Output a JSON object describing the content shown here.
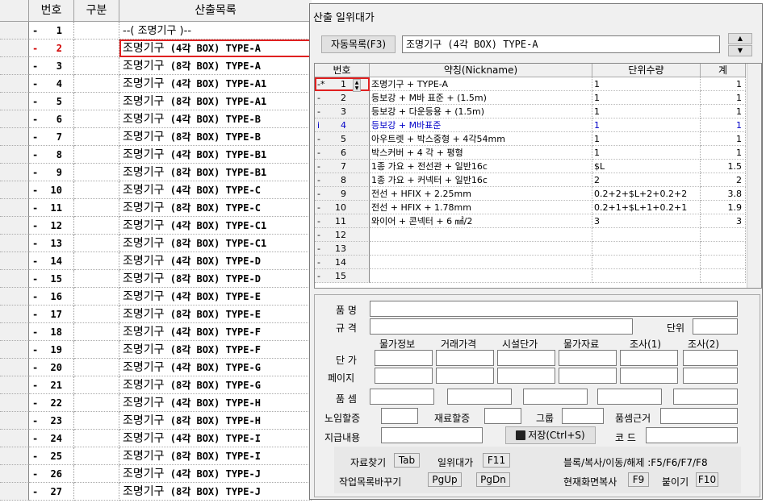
{
  "left_grid": {
    "headers": [
      "번호",
      "구분",
      "산출목록"
    ],
    "rows": [
      {
        "mark": "-",
        "num": "1",
        "text": "--( 조명기구 )--",
        "kind": "title"
      },
      {
        "mark": "-",
        "num": "2",
        "k": "조명기구",
        "b": "(4각 BOX) TYPE-A",
        "red": true,
        "selected": true
      },
      {
        "mark": "-",
        "num": "3",
        "k": "조명기구",
        "b": "(8각 BOX) TYPE-A"
      },
      {
        "mark": "-",
        "num": "4",
        "k": "조명기구",
        "b": "(4각 BOX) TYPE-A1"
      },
      {
        "mark": "-",
        "num": "5",
        "k": "조명기구",
        "b": "(8각 BOX) TYPE-A1"
      },
      {
        "mark": "-",
        "num": "6",
        "k": "조명기구",
        "b": "(4각 BOX) TYPE-B"
      },
      {
        "mark": "-",
        "num": "7",
        "k": "조명기구",
        "b": "(8각 BOX) TYPE-B"
      },
      {
        "mark": "-",
        "num": "8",
        "k": "조명기구",
        "b": "(4각 BOX) TYPE-B1"
      },
      {
        "mark": "-",
        "num": "9",
        "k": "조명기구",
        "b": "(8각 BOX) TYPE-B1"
      },
      {
        "mark": "-",
        "num": "10",
        "k": "조명기구",
        "b": "(4각 BOX) TYPE-C"
      },
      {
        "mark": "-",
        "num": "11",
        "k": "조명기구",
        "b": "(8각 BOX) TYPE-C"
      },
      {
        "mark": "-",
        "num": "12",
        "k": "조명기구",
        "b": "(4각 BOX) TYPE-C1"
      },
      {
        "mark": "-",
        "num": "13",
        "k": "조명기구",
        "b": "(8각 BOX) TYPE-C1"
      },
      {
        "mark": "-",
        "num": "14",
        "k": "조명기구",
        "b": "(4각 BOX) TYPE-D"
      },
      {
        "mark": "-",
        "num": "15",
        "k": "조명기구",
        "b": "(8각 BOX) TYPE-D"
      },
      {
        "mark": "-",
        "num": "16",
        "k": "조명기구",
        "b": "(4각 BOX) TYPE-E"
      },
      {
        "mark": "-",
        "num": "17",
        "k": "조명기구",
        "b": "(8각 BOX) TYPE-E"
      },
      {
        "mark": "-",
        "num": "18",
        "k": "조명기구",
        "b": "(4각 BOX) TYPE-F"
      },
      {
        "mark": "-",
        "num": "19",
        "k": "조명기구",
        "b": "(8각 BOX) TYPE-F"
      },
      {
        "mark": "-",
        "num": "20",
        "k": "조명기구",
        "b": "(4각 BOX) TYPE-G"
      },
      {
        "mark": "-",
        "num": "21",
        "k": "조명기구",
        "b": "(8각 BOX) TYPE-G"
      },
      {
        "mark": "-",
        "num": "22",
        "k": "조명기구",
        "b": "(4각 BOX) TYPE-H"
      },
      {
        "mark": "-",
        "num": "23",
        "k": "조명기구",
        "b": "(8각 BOX) TYPE-H"
      },
      {
        "mark": "-",
        "num": "24",
        "k": "조명기구",
        "b": "(4각 BOX) TYPE-I"
      },
      {
        "mark": "-",
        "num": "25",
        "k": "조명기구",
        "b": "(8각 BOX) TYPE-I"
      },
      {
        "mark": "-",
        "num": "26",
        "k": "조명기구",
        "b": "(4각 BOX) TYPE-J"
      },
      {
        "mark": "-",
        "num": "27",
        "k": "조명기구",
        "b": "(8각 BOX) TYPE-J"
      }
    ]
  },
  "dialog": {
    "title": "산출 일위대가",
    "auto_list_button": "자동목록(F3)",
    "item_name": "조명기구 (4각 BOX) TYPE-A",
    "grid_headers": [
      "번호",
      "약칭(Nickname)",
      "단위수량",
      "계"
    ],
    "grid_rows": [
      {
        "mark": "-*",
        "num": "1",
        "name": "조명기구 + TYPE-A",
        "qty": "1",
        "total": "1"
      },
      {
        "mark": "-",
        "num": "2",
        "name": "등보강 + M바 표준 + (1.5m)",
        "qty": "1",
        "total": "1"
      },
      {
        "mark": "-",
        "num": "3",
        "name": "등보강 + 다운등용 + (1.5m)",
        "qty": "1",
        "total": "1"
      },
      {
        "mark": "i",
        "num": "4",
        "name": "등보강 + M바표준",
        "qty": "1",
        "total": "1",
        "blue": true
      },
      {
        "mark": "-",
        "num": "5",
        "name": "아우트렛 + 박스중형 + 4각54mm",
        "qty": "1",
        "total": "1"
      },
      {
        "mark": "-",
        "num": "6",
        "name": "박스커버 + 4 각 + 평형",
        "qty": "1",
        "total": "1"
      },
      {
        "mark": "-",
        "num": "7",
        "name": "1종 가요 + 전선관 + 일반16c",
        "qty": "$L",
        "total": "1.5"
      },
      {
        "mark": "-",
        "num": "8",
        "name": "1종 가요 + 커넥터 + 일반16c",
        "qty": "2",
        "total": "2"
      },
      {
        "mark": "-",
        "num": "9",
        "name": "전선 + HFIX + 2.25mm",
        "qty": "0.2+2+$L+2+0.2+2",
        "total": "3.8"
      },
      {
        "mark": "-",
        "num": "10",
        "name": "전선 + HFIX + 1.78mm",
        "qty": "0.2+1+$L+1+0.2+1",
        "total": "1.9"
      },
      {
        "mark": "-",
        "num": "11",
        "name": "와이어 + 콘넥터 + 6 ㎟/2",
        "qty": "3",
        "total": "3"
      },
      {
        "mark": "-",
        "num": "12",
        "name": "",
        "qty": "",
        "total": ""
      },
      {
        "mark": "-",
        "num": "13",
        "name": "",
        "qty": "",
        "total": ""
      },
      {
        "mark": "-",
        "num": "14",
        "name": "",
        "qty": "",
        "total": ""
      },
      {
        "mark": "-",
        "num": "15",
        "name": "",
        "qty": "",
        "total": ""
      }
    ],
    "form": {
      "product_name": "품 명",
      "spec": "규 격",
      "unit": "단위",
      "col_headers": [
        "물가정보",
        "거래가격",
        "시설단가",
        "물가자료",
        "조사(1)",
        "조사(2)"
      ],
      "unit_price": "단  가",
      "page": "페이지",
      "product_calc": "품  셈",
      "labor_ratio": "노임할증",
      "material_ratio": "재료할증",
      "group": "그룹",
      "calc_basis": "품셈근거",
      "payment": "지급내용",
      "save_button": "저장(Ctrl+S)",
      "code": "코 드"
    },
    "shortcuts": {
      "find_label": "자료찾기",
      "find_key": "Tab",
      "unit_cost_label": "일위대가",
      "unit_cost_key": "F11",
      "block_label": "블록/복사/이동/해제 :F5/F6/F7/F8",
      "switch_label": "작업목록바꾸기",
      "pgup_key": "PgUp",
      "pgdn_key": "PgDn",
      "copy_screen_label": "현재화면복사",
      "copy_screen_key": "F9",
      "paste_label": "붙이기",
      "paste_key": "F10"
    }
  }
}
